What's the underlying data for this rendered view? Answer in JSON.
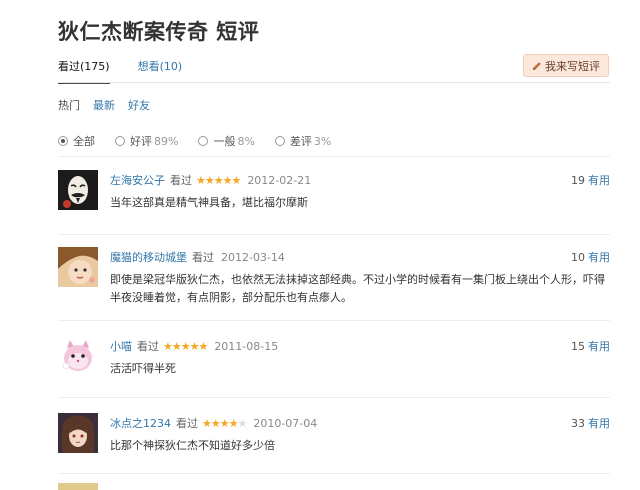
{
  "page": {
    "title": "狄仁杰断案传奇 短评"
  },
  "tabs": [
    {
      "label": "看过(175)",
      "active": true
    },
    {
      "label": "想看(10)",
      "active": false
    }
  ],
  "write_button": {
    "label": "我来写短评",
    "icon": "pencil-icon"
  },
  "sort_links": [
    {
      "label": "热门",
      "active": true
    },
    {
      "label": "最新",
      "active": false
    },
    {
      "label": "好友",
      "active": false
    }
  ],
  "filters": [
    {
      "label": "全部",
      "pct": "",
      "checked": true
    },
    {
      "label": "好评",
      "pct": "89%",
      "checked": false
    },
    {
      "label": "一般",
      "pct": "8%",
      "checked": false
    },
    {
      "label": "差评",
      "pct": "3%",
      "checked": false
    }
  ],
  "comments": [
    {
      "user": "左海安公子",
      "status": "看过",
      "rating": 5,
      "date": "2012-02-21",
      "votes": "19",
      "useful_label": "有用",
      "text": "当年这部真是精气神具备，堪比福尔摩斯",
      "avatar": "mask-avatar"
    },
    {
      "user": "魔猫的移动城堡",
      "status": "看过",
      "rating": 0,
      "date": "2012-03-14",
      "votes": "10",
      "useful_label": "有用",
      "text": "即使是梁冠华版狄仁杰，也依然无法抹掉这部经典。不过小学的时候看有一集门板上绕出个人形，吓得半夜没睡着觉，有点阴影，部分配乐也有点瘆人。",
      "avatar": "girl-avatar"
    },
    {
      "user": "小喵",
      "status": "看过",
      "rating": 5,
      "date": "2011-08-15",
      "votes": "15",
      "useful_label": "有用",
      "text": "活活吓得半死",
      "avatar": "cat-avatar"
    },
    {
      "user": "冰点之1234",
      "status": "看过",
      "rating": 4,
      "date": "2010-07-04",
      "votes": "33",
      "useful_label": "有用",
      "text": "比那个神探狄仁杰不知道好多少倍",
      "avatar": "anime-avatar"
    }
  ],
  "colors": {
    "link": "#3377aa",
    "star": "#f5a623",
    "button_bg": "#fbe7db"
  }
}
